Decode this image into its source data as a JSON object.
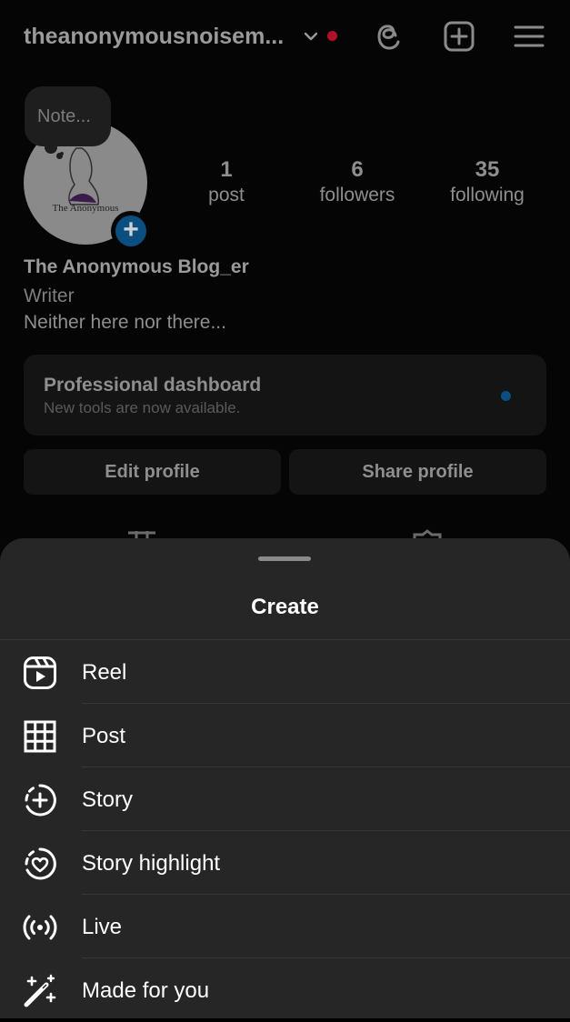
{
  "header": {
    "username": "theanonymousnoisem...",
    "icons": [
      "chevron-down-icon",
      "threads-icon",
      "new-post-icon",
      "menu-icon"
    ]
  },
  "note": {
    "placeholder": "Note..."
  },
  "avatar": {
    "caption": "The Anonymous"
  },
  "stats": [
    {
      "value": "1",
      "label": "post"
    },
    {
      "value": "6",
      "label": "followers"
    },
    {
      "value": "35",
      "label": "following"
    }
  ],
  "bio": {
    "name": "The Anonymous Blog_er",
    "category": "Writer",
    "text": "Neither here nor there..."
  },
  "dashboard": {
    "title": "Professional dashboard",
    "subtitle": "New tools are now available."
  },
  "buttons": {
    "edit": "Edit profile",
    "share": "Share profile"
  },
  "sheet": {
    "title": "Create",
    "items": [
      {
        "label": "Reel",
        "icon": "reel-icon"
      },
      {
        "label": "Post",
        "icon": "grid-icon"
      },
      {
        "label": "Story",
        "icon": "story-add-icon"
      },
      {
        "label": "Story highlight",
        "icon": "highlight-heart-icon"
      },
      {
        "label": "Live",
        "icon": "live-icon"
      },
      {
        "label": "Made for you",
        "icon": "magic-wand-icon"
      }
    ]
  },
  "colors": {
    "sheet_bg": "#262626",
    "accent_blue": "#0a4f80",
    "notification_red": "#b0102a"
  }
}
